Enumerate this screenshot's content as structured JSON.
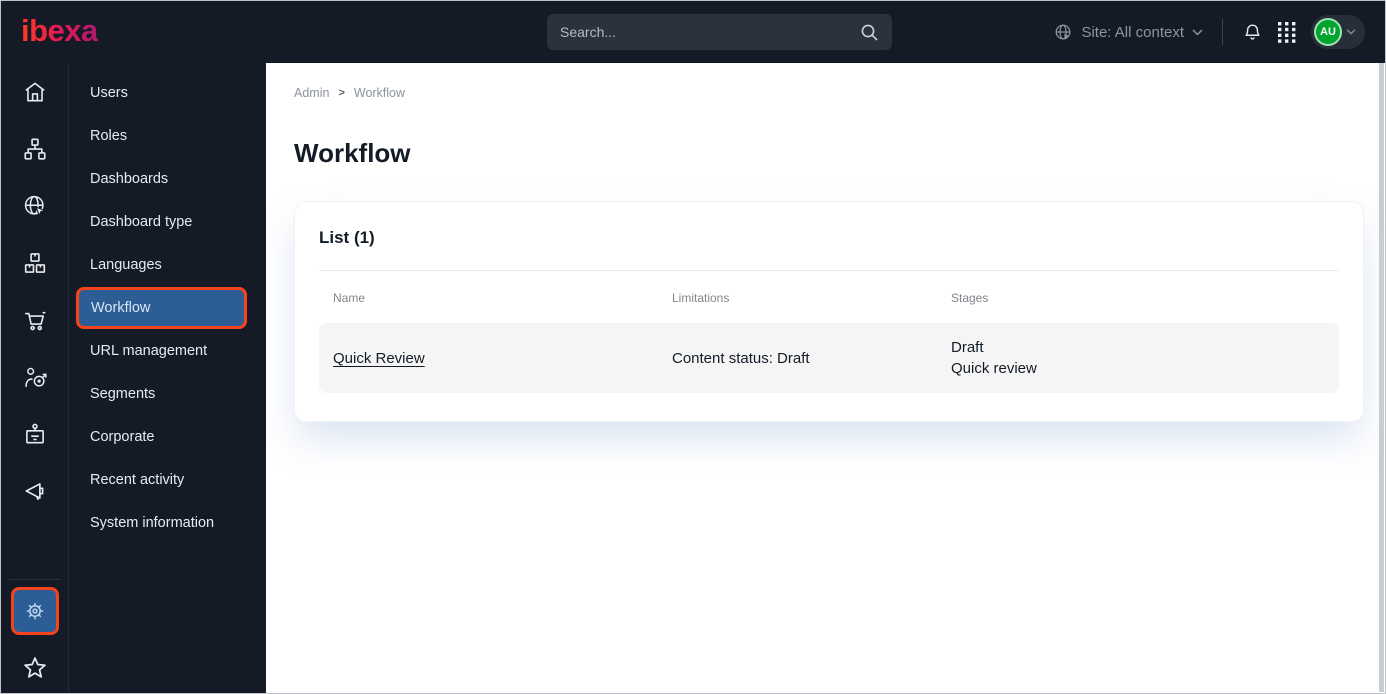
{
  "topbar": {
    "logo": "ibexa",
    "search_placeholder": "Search...",
    "site_context": "Site: All context",
    "avatar_initials": "AU"
  },
  "sidebar": {
    "rail_icons": [
      "home",
      "content-tree",
      "site",
      "products",
      "commerce",
      "personalization",
      "corporate",
      "marketing",
      "admin-gear",
      "bookmarks-star"
    ],
    "menu_items": [
      {
        "label": "Users",
        "active": false
      },
      {
        "label": "Roles",
        "active": false
      },
      {
        "label": "Dashboards",
        "active": false
      },
      {
        "label": "Dashboard type",
        "active": false
      },
      {
        "label": "Languages",
        "active": false
      },
      {
        "label": "Workflow",
        "active": true
      },
      {
        "label": "URL management",
        "active": false
      },
      {
        "label": "Segments",
        "active": false
      },
      {
        "label": "Corporate",
        "active": false
      },
      {
        "label": "Recent activity",
        "active": false
      },
      {
        "label": "System information",
        "active": false
      }
    ]
  },
  "breadcrumb": {
    "items": [
      "Admin",
      "Workflow"
    ],
    "separator": ">"
  },
  "page": {
    "title": "Workflow"
  },
  "list_card": {
    "title": "List (1)",
    "columns": [
      "Name",
      "Limitations",
      "Stages"
    ],
    "rows": [
      {
        "name": "Quick Review",
        "limitations": "Content status: Draft",
        "stages": [
          "Draft",
          "Quick review"
        ]
      }
    ]
  },
  "colors": {
    "topbar_bg": "#141b26",
    "active_blue": "#2c5d94",
    "highlight_orange": "#f4441d",
    "avatar_green": "#00a42e",
    "row_bg": "#f5f5f6",
    "logo_gradient_start": "#ff3b24",
    "logo_gradient_end": "#ae1a6e"
  }
}
